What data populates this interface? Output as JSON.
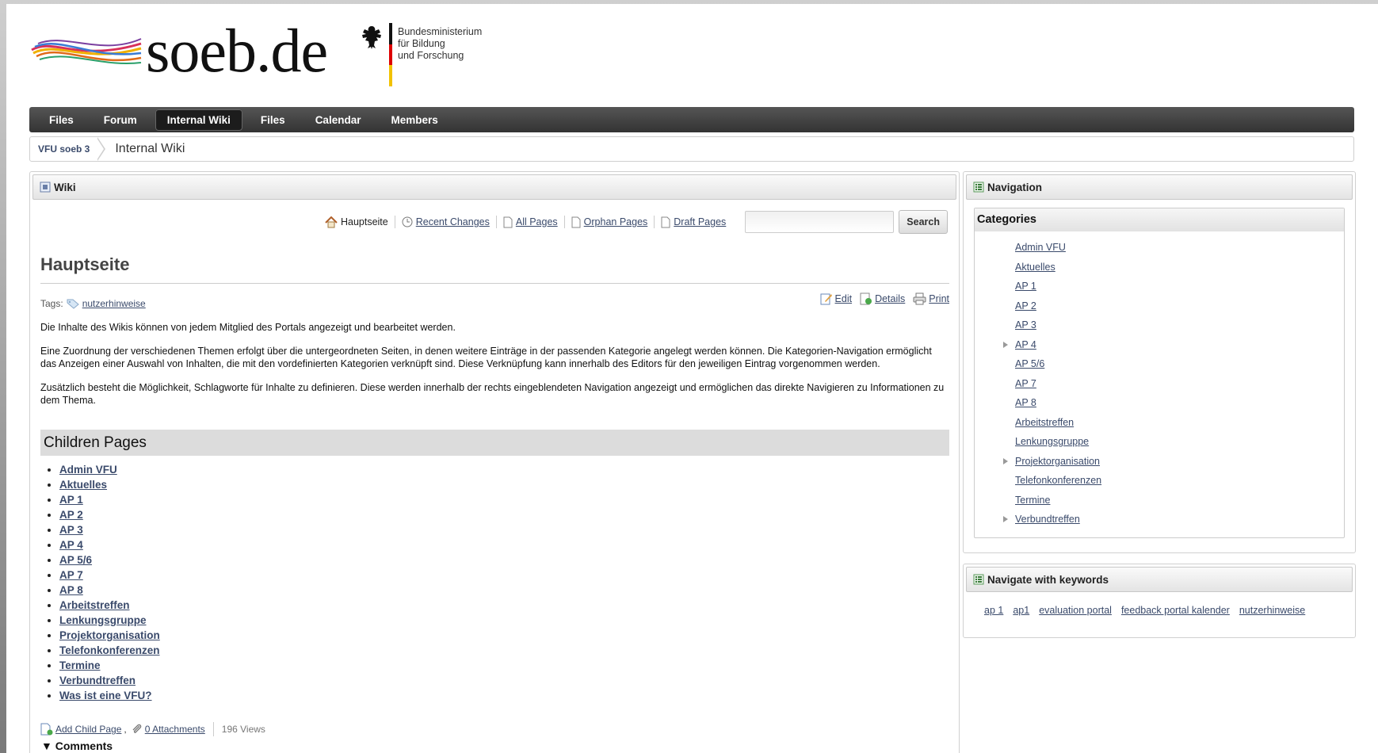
{
  "header": {
    "site_logo_text": "soeb.de",
    "ministry_text": "Bundesministerium\nfür Bildung\nund Forschung"
  },
  "nav": {
    "items": [
      {
        "label": "Files"
      },
      {
        "label": "Forum"
      },
      {
        "label": "Internal Wiki",
        "active": true
      },
      {
        "label": "Files"
      },
      {
        "label": "Calendar"
      },
      {
        "label": "Members"
      }
    ]
  },
  "breadcrumb": {
    "group": "VFU soeb 3",
    "current": "Internal Wiki"
  },
  "wiki": {
    "panel_title": "Wiki",
    "toolbar": {
      "home": "Hauptseite",
      "recent_changes": "Recent Changes",
      "all_pages": "All Pages",
      "orphan_pages": "Orphan Pages",
      "draft_pages": "Draft Pages",
      "search_value": "",
      "search_button": "Search"
    },
    "page_title": "Hauptseite",
    "tags_label": "Tags:",
    "tag": "nutzerhinweise",
    "actions": {
      "edit": "Edit",
      "details": "Details",
      "print": "Print"
    },
    "paragraphs": [
      "Die Inhalte des Wikis können von jedem Mitglied des Portals angezeigt und bearbeitet werden.",
      "Eine Zuordnung der verschiedenen Themen erfolgt über die untergeordneten Seiten, in denen weitere Einträge in der passenden Kategorie angelegt werden können. Die Kategorien-Navigation ermöglicht das Anzeigen einer Auswahl von Inhalten, die mit den vordefinierten Kategorien verknüpft sind. Diese Verknüpfung kann innerhalb des Editors für den jeweiligen Eintrag vorgenommen werden.",
      "Zusätzlich besteht die Möglichkeit, Schlagworte für Inhalte zu definieren. Diese werden innerhalb der rechts eingeblendeten Navigation angezeigt und ermöglichen das direkte Navigieren zu Informationen zu dem Thema."
    ],
    "children_title": "Children Pages",
    "children": [
      "Admin VFU",
      "Aktuelles",
      "AP 1",
      "AP 2",
      "AP 3",
      "AP 4",
      "AP 5/6",
      "AP 7",
      "AP 8",
      "Arbeitstreffen",
      "Lenkungsgruppe",
      "Projektorganisation",
      "Telefonkonferenzen",
      "Termine",
      "Verbundtreffen",
      "Was ist eine VFU?"
    ],
    "footer": {
      "add_child": "Add Child Page",
      "comma": ",",
      "attachments": "0 Attachments",
      "views": "196 Views"
    },
    "comments_label": "Comments"
  },
  "navigation": {
    "panel_title": "Navigation",
    "categories_title": "Categories",
    "categories": [
      {
        "label": "Admin VFU",
        "expandable": false
      },
      {
        "label": "Aktuelles",
        "expandable": false
      },
      {
        "label": "AP 1",
        "expandable": false
      },
      {
        "label": "AP 2",
        "expandable": false
      },
      {
        "label": "AP 3",
        "expandable": false
      },
      {
        "label": "AP 4",
        "expandable": true
      },
      {
        "label": "AP 5/6",
        "expandable": false
      },
      {
        "label": "AP 7",
        "expandable": false
      },
      {
        "label": "AP 8",
        "expandable": false
      },
      {
        "label": "Arbeitstreffen",
        "expandable": false
      },
      {
        "label": "Lenkungsgruppe",
        "expandable": false
      },
      {
        "label": "Projektorganisation",
        "expandable": true
      },
      {
        "label": "Telefonkonferenzen",
        "expandable": false
      },
      {
        "label": "Termine",
        "expandable": false
      },
      {
        "label": "Verbundtreffen",
        "expandable": true
      }
    ]
  },
  "keywords": {
    "panel_title": "Navigate with keywords",
    "items": [
      "ap 1",
      "ap1",
      "evaluation portal",
      "feedback portal kalender",
      "nutzerhinweise"
    ]
  },
  "colors": {
    "link": "#3a4a6b",
    "navbar": "#3b3b3b",
    "section_band": "#dcdcdc"
  }
}
